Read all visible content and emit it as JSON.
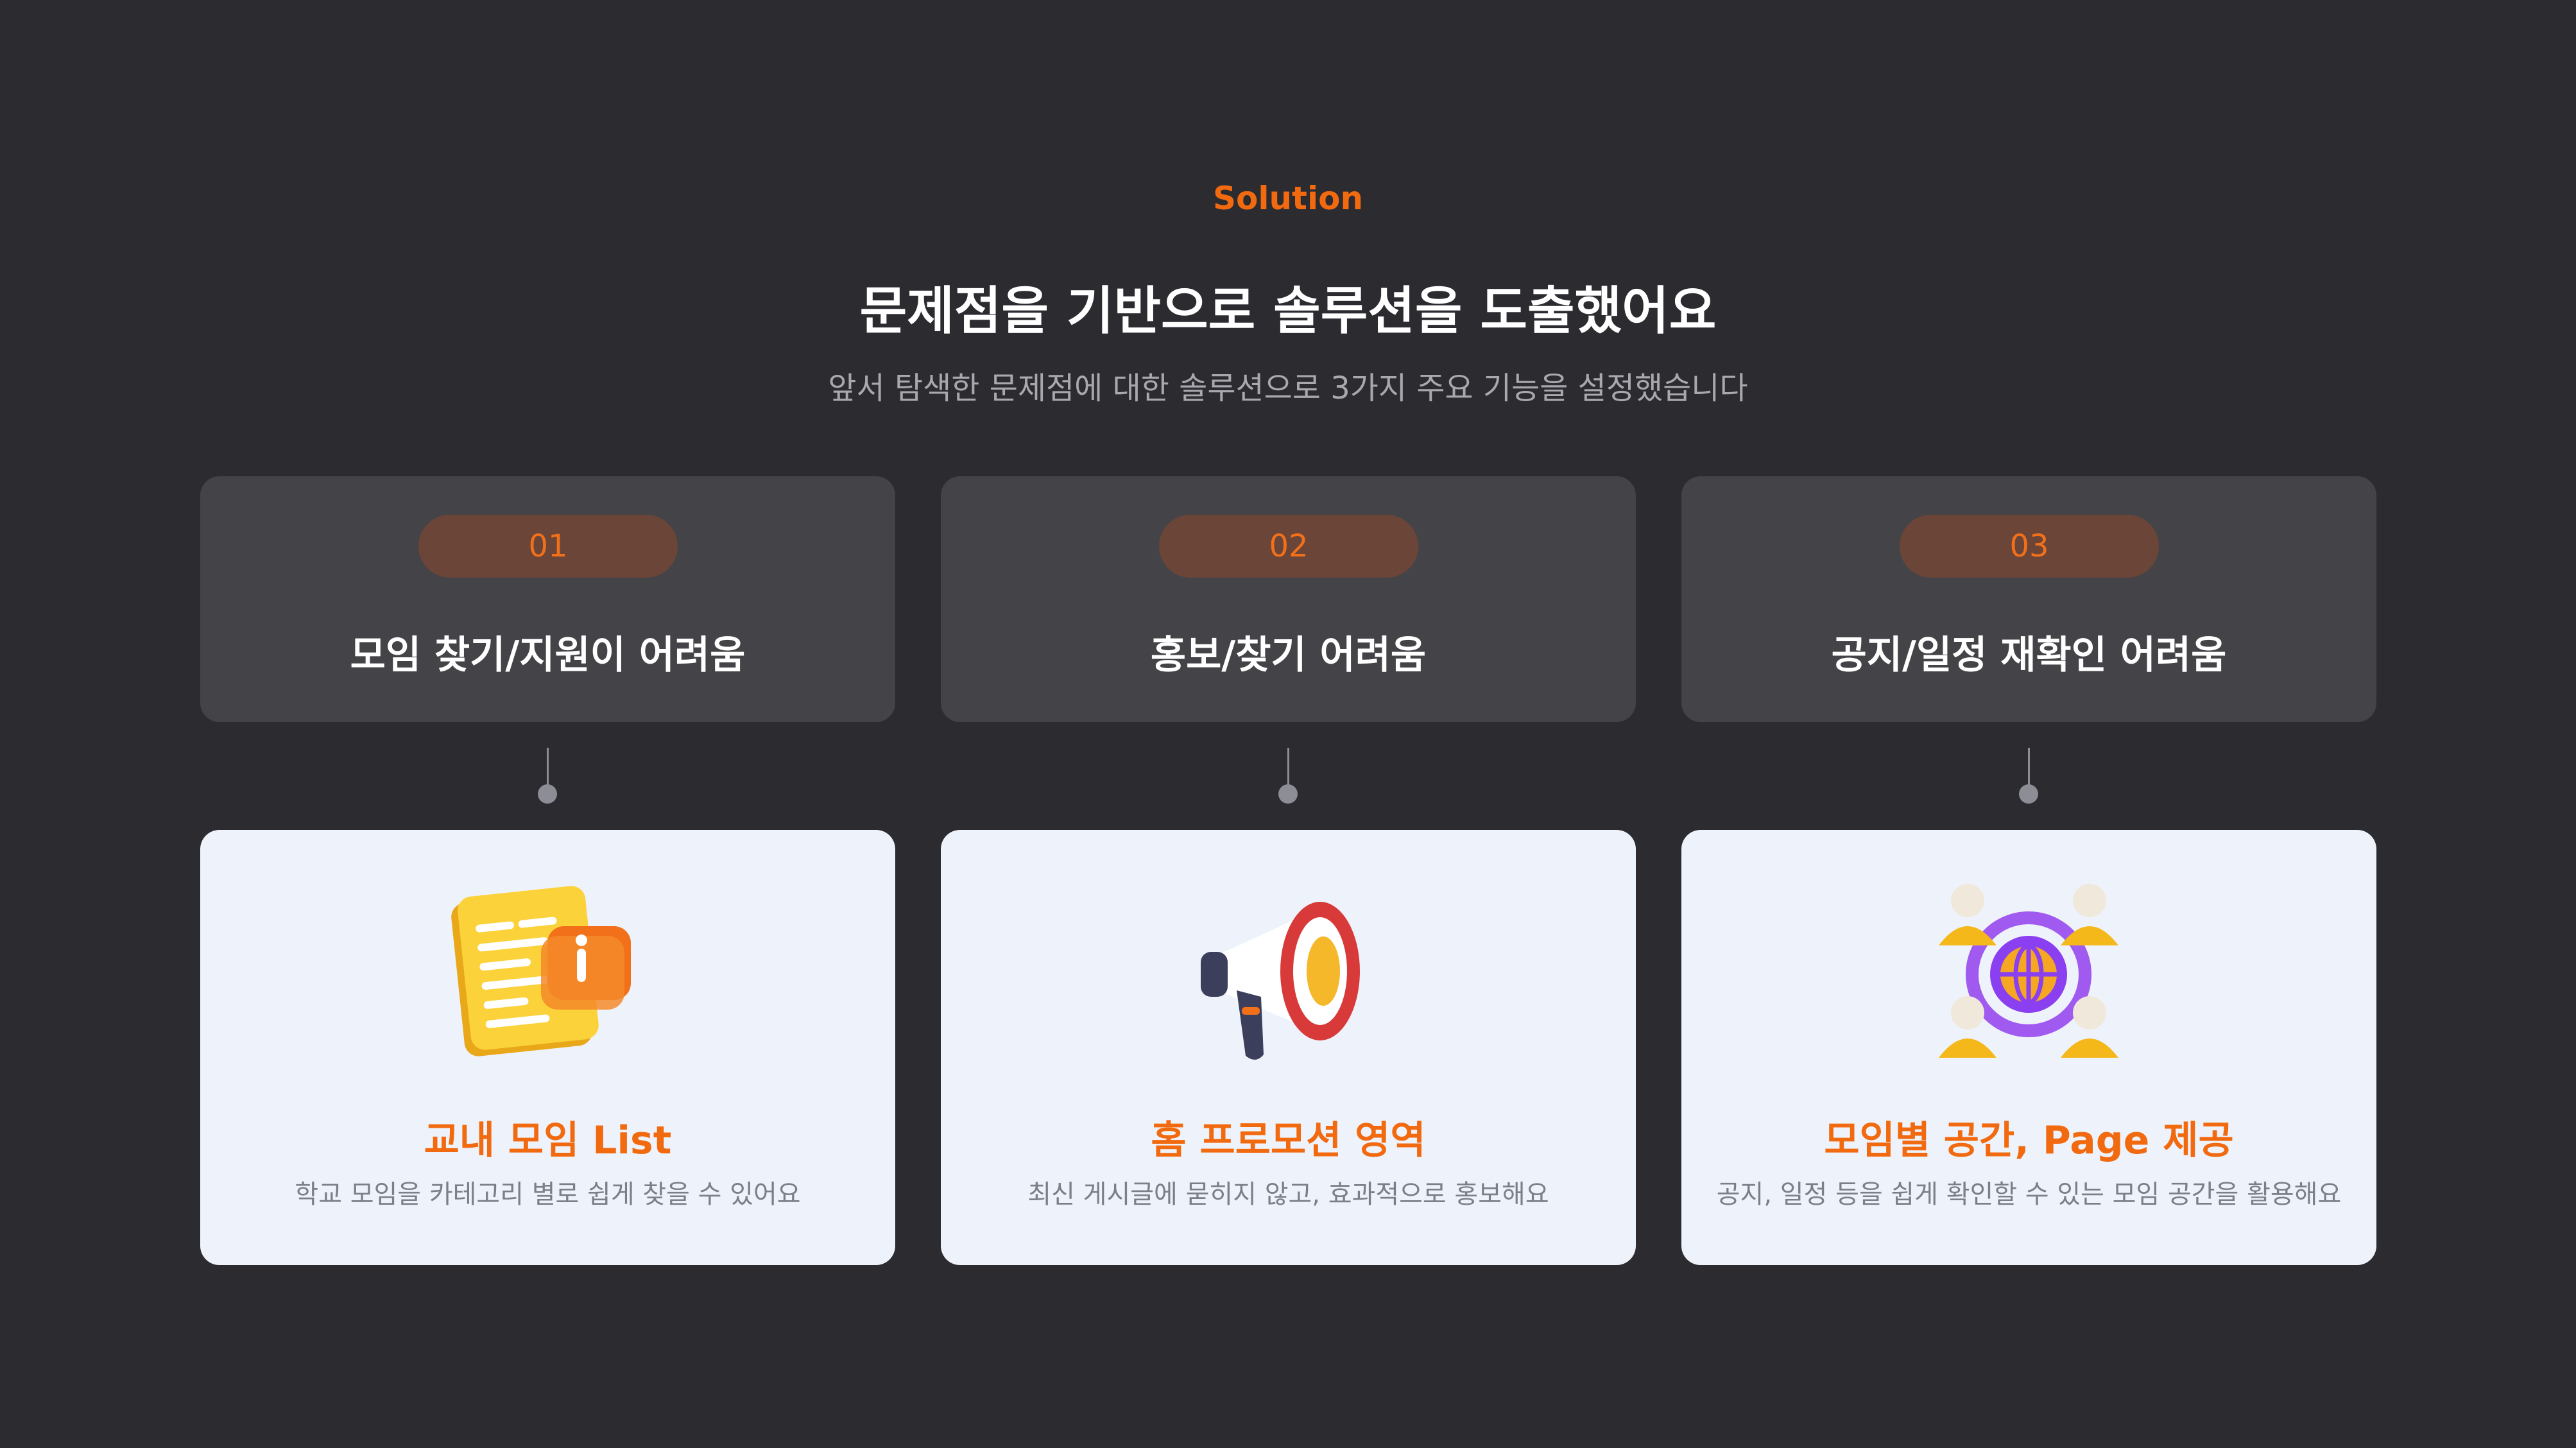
{
  "header": {
    "eyebrow": "Solution",
    "title": "문제점을 기반으로 솔루션을 도출했어요",
    "subtitle": "앞서 탐색한 문제점에 대한 솔루션으로 3가지 주요 기능을 설정했습니다"
  },
  "columns": [
    {
      "number": "01",
      "problem": "모임 찾기/지원이 어려움",
      "solution_title": "교내 모임 List",
      "solution_desc": "학교 모임을 카테고리 별로 쉽게 찾을 수 있어요",
      "icon": "document-info-icon"
    },
    {
      "number": "02",
      "problem": "홍보/찾기 어려움",
      "solution_title": "홈 프로모션 영역",
      "solution_desc": "최신 게시글에 묻히지 않고, 효과적으로 홍보해요",
      "icon": "megaphone-icon"
    },
    {
      "number": "03",
      "problem": "공지/일정 재확인 어려움",
      "solution_title": "모임별 공간, Page 제공",
      "solution_desc": "공지, 일정 등을 쉽게 확인할 수 있는 모임 공간을 활용해요",
      "icon": "community-globe-icon"
    }
  ],
  "colors": {
    "background": "#2c2b30",
    "accent": "#f26a10",
    "problem_card": "#444448",
    "solution_card": "#eef3fb"
  }
}
